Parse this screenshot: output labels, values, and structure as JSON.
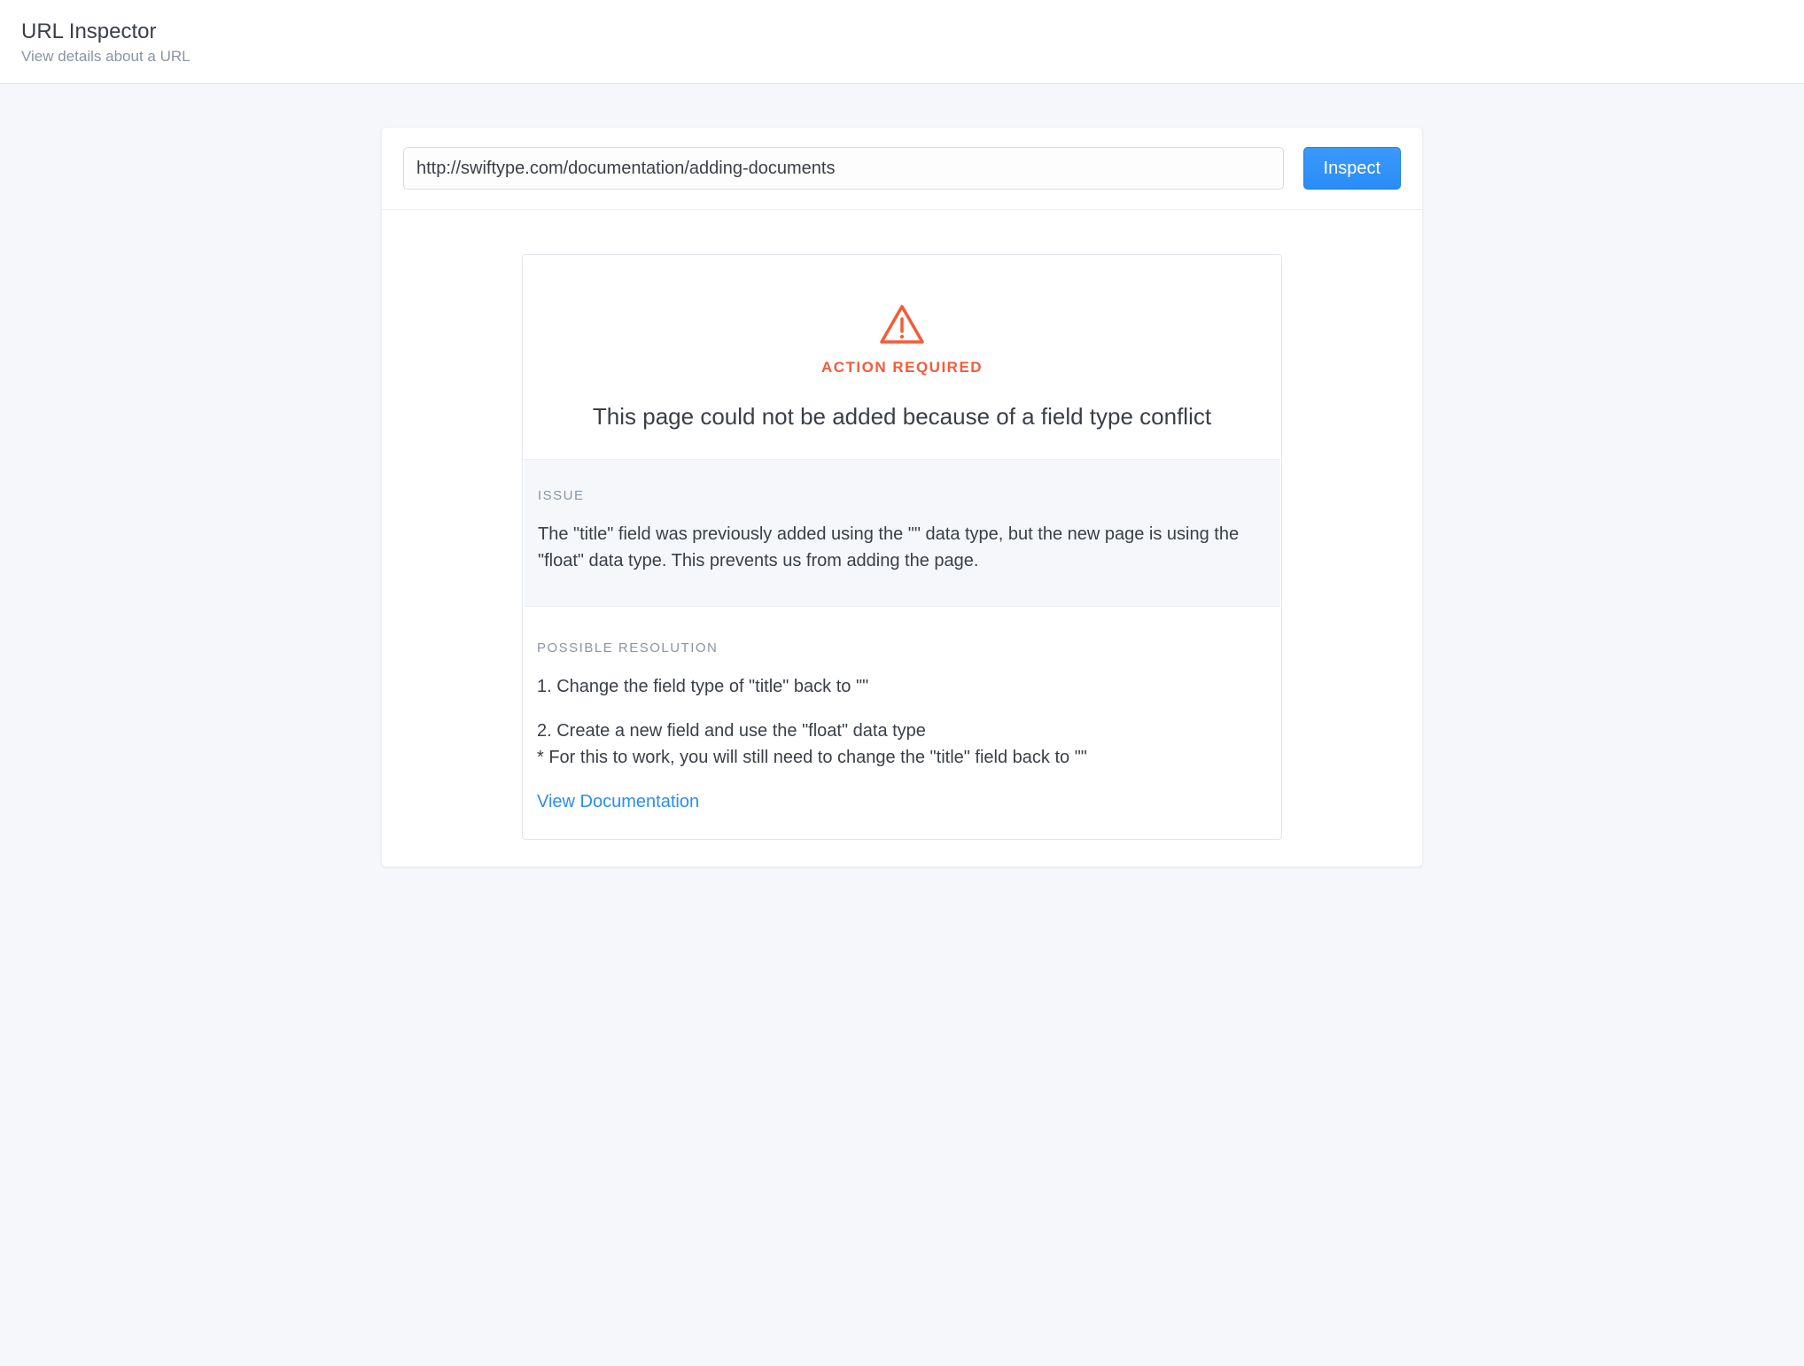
{
  "header": {
    "title": "URL Inspector",
    "subtitle": "View details about a URL"
  },
  "inspect": {
    "url_value": "http://swiftype.com/documentation/adding-documents",
    "button_label": "Inspect"
  },
  "result": {
    "badge": "ACTION REQUIRED",
    "headline": "This page could not be added because of a field type conflict",
    "issue": {
      "label": "ISSUE",
      "text": "The \"title\" field was previously added using the \"\" data type, but the new page is using the \"float\" data type. This prevents us from adding the page."
    },
    "resolution": {
      "label": "POSSIBLE RESOLUTION",
      "line1": "1. Change the field type of \"title\" back to \"\"",
      "line2": "2. Create a new field and use the \"float\" data type",
      "line3": "* For this to work, you will still need to change the \"title\" field back to \"\"",
      "doc_link": "View Documentation"
    }
  },
  "colors": {
    "accent": "#2a8df6",
    "warn": "#f65a39"
  }
}
